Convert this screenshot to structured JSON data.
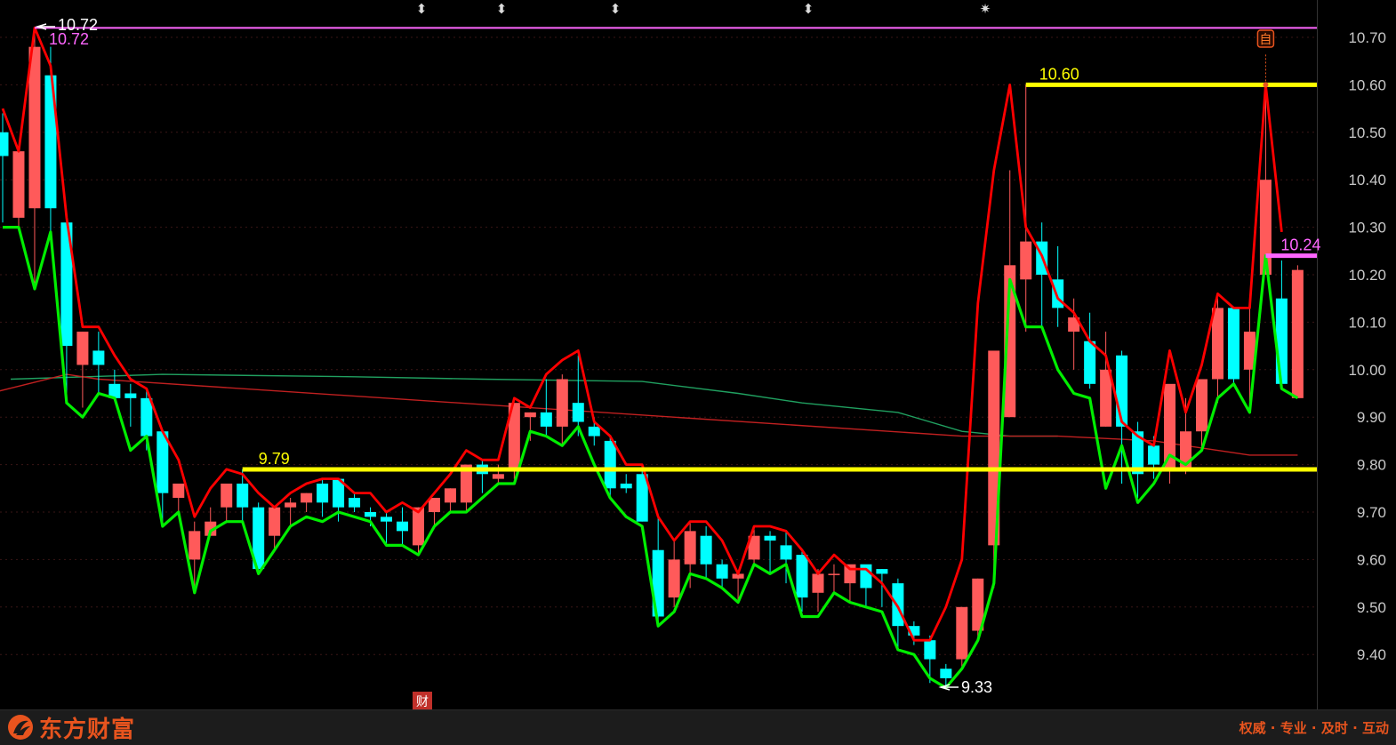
{
  "chart_data": {
    "type": "candlestick",
    "ylim": [
      9.3,
      10.75
    ],
    "y_ticks": [
      "10.70",
      "10.60",
      "10.50",
      "10.40",
      "10.30",
      "10.20",
      "10.10",
      "10.00",
      "9.90",
      "9.80",
      "9.70",
      "9.60",
      "9.50",
      "9.40"
    ],
    "candles": [
      [
        10.5,
        10.54,
        10.45,
        10.31
      ],
      [
        10.32,
        10.38,
        10.46,
        10.3
      ],
      [
        10.34,
        10.72,
        10.68,
        10.18
      ],
      [
        10.62,
        10.68,
        10.34,
        10.29
      ],
      [
        10.31,
        10.31,
        10.05,
        9.95
      ],
      [
        10.01,
        10.08,
        10.08,
        9.92
      ],
      [
        10.04,
        10.08,
        10.01,
        9.95
      ],
      [
        9.97,
        10.0,
        9.94,
        9.94
      ],
      [
        9.95,
        9.97,
        9.94,
        9.88
      ],
      [
        9.94,
        9.96,
        9.86,
        9.83
      ],
      [
        9.87,
        9.87,
        9.74,
        9.67
      ],
      [
        9.73,
        9.75,
        9.76,
        9.7
      ],
      [
        9.6,
        9.68,
        9.66,
        9.53
      ],
      [
        9.65,
        9.71,
        9.68,
        9.66
      ],
      [
        9.71,
        9.75,
        9.76,
        9.68
      ],
      [
        9.76,
        9.79,
        9.71,
        9.68
      ],
      [
        9.71,
        9.72,
        9.58,
        9.57
      ],
      [
        9.65,
        9.7,
        9.71,
        9.62
      ],
      [
        9.71,
        9.73,
        9.72,
        9.67
      ],
      [
        9.72,
        9.74,
        9.74,
        9.7
      ],
      [
        9.76,
        9.77,
        9.72,
        9.69
      ],
      [
        9.77,
        9.77,
        9.71,
        9.68
      ],
      [
        9.73,
        9.74,
        9.71,
        9.7
      ],
      [
        9.7,
        9.71,
        9.69,
        9.67
      ],
      [
        9.69,
        9.7,
        9.68,
        9.63
      ],
      [
        9.68,
        9.71,
        9.66,
        9.63
      ],
      [
        9.63,
        9.71,
        9.71,
        9.61
      ],
      [
        9.7,
        9.73,
        9.73,
        9.67
      ],
      [
        9.72,
        9.75,
        9.75,
        9.7
      ],
      [
        9.72,
        9.8,
        9.8,
        9.7
      ],
      [
        9.8,
        9.81,
        9.78,
        9.74
      ],
      [
        9.77,
        9.8,
        9.78,
        9.76
      ],
      [
        9.79,
        9.93,
        9.93,
        9.77
      ],
      [
        9.9,
        9.91,
        9.91,
        9.85
      ],
      [
        9.91,
        9.98,
        9.88,
        9.86
      ],
      [
        9.88,
        9.99,
        9.98,
        9.84
      ],
      [
        9.93,
        10.03,
        9.89,
        9.86
      ],
      [
        9.88,
        9.9,
        9.86,
        9.84
      ],
      [
        9.85,
        9.86,
        9.75,
        9.73
      ],
      [
        9.76,
        9.78,
        9.75,
        9.74
      ],
      [
        9.78,
        9.8,
        9.68,
        9.68
      ],
      [
        9.62,
        9.69,
        9.48,
        9.46
      ],
      [
        9.52,
        9.64,
        9.6,
        9.5
      ],
      [
        9.59,
        9.68,
        9.66,
        9.54
      ],
      [
        9.65,
        9.67,
        9.59,
        9.56
      ],
      [
        9.59,
        9.6,
        9.56,
        9.54
      ],
      [
        9.56,
        9.57,
        9.57,
        9.51
      ],
      [
        9.6,
        9.67,
        9.65,
        9.59
      ],
      [
        9.65,
        9.66,
        9.64,
        9.57
      ],
      [
        9.63,
        9.66,
        9.6,
        9.55
      ],
      [
        9.61,
        9.62,
        9.52,
        9.49
      ],
      [
        9.53,
        9.58,
        9.57,
        9.49
      ],
      [
        9.57,
        9.59,
        9.57,
        9.53
      ],
      [
        9.55,
        9.58,
        9.59,
        9.51
      ],
      [
        9.59,
        9.58,
        9.54,
        9.5
      ],
      [
        9.58,
        9.58,
        9.57,
        9.5
      ],
      [
        9.55,
        9.56,
        9.46,
        9.41
      ],
      [
        9.46,
        9.47,
        9.44,
        9.42
      ],
      [
        9.43,
        9.44,
        9.39,
        9.34
      ],
      [
        9.37,
        9.38,
        9.35,
        9.33
      ],
      [
        9.39,
        9.5,
        9.5,
        9.37
      ],
      [
        9.45,
        9.56,
        9.56,
        9.43
      ],
      [
        9.63,
        10.04,
        10.04,
        9.54
      ],
      [
        9.9,
        10.42,
        10.22,
        9.91
      ],
      [
        10.19,
        10.6,
        10.27,
        10.08
      ],
      [
        10.27,
        10.31,
        10.2,
        10.09
      ],
      [
        10.19,
        10.26,
        10.13,
        10.09
      ],
      [
        10.08,
        10.15,
        10.11,
        10.0
      ],
      [
        10.06,
        10.12,
        9.97,
        9.96
      ],
      [
        9.88,
        10.08,
        10.0,
        9.88
      ],
      [
        10.03,
        10.04,
        9.88,
        9.76
      ],
      [
        9.87,
        9.89,
        9.78,
        9.73
      ],
      [
        9.84,
        9.86,
        9.8,
        9.77
      ],
      [
        9.79,
        9.86,
        9.97,
        9.76
      ],
      [
        9.79,
        9.94,
        9.87,
        9.78
      ],
      [
        9.87,
        9.97,
        9.98,
        9.83
      ],
      [
        9.98,
        10.15,
        10.13,
        9.93
      ],
      [
        10.13,
        10.12,
        9.98,
        9.97
      ],
      [
        10.0,
        10.13,
        10.08,
        9.91
      ],
      [
        10.2,
        10.6,
        10.4,
        10.24
      ],
      [
        10.15,
        10.23,
        9.97,
        9.97
      ],
      [
        9.94,
        10.22,
        10.21,
        9.94
      ]
    ],
    "upper_band": [
      10.55,
      10.46,
      10.72,
      10.64,
      10.32,
      10.09,
      10.09,
      10.03,
      9.98,
      9.96,
      9.87,
      9.81,
      9.69,
      9.75,
      9.79,
      9.78,
      9.74,
      9.71,
      9.74,
      9.76,
      9.77,
      9.77,
      9.74,
      9.74,
      9.7,
      9.72,
      9.7,
      9.74,
      9.78,
      9.83,
      9.81,
      9.81,
      9.94,
      9.92,
      9.99,
      10.02,
      10.04,
      9.89,
      9.86,
      9.8,
      9.8,
      9.69,
      9.64,
      9.68,
      9.68,
      9.64,
      9.57,
      9.67,
      9.67,
      9.66,
      9.62,
      9.57,
      9.61,
      9.58,
      9.58,
      9.55,
      9.5,
      9.43,
      9.43,
      9.5,
      9.6,
      10.14,
      10.42,
      10.6,
      10.3,
      10.24,
      10.15,
      10.12,
      10.06,
      10.03,
      9.89,
      9.86,
      9.84,
      10.04,
      9.91,
      10.01,
      10.16,
      10.13,
      10.13,
      10.6,
      10.29
    ],
    "lower_band": [
      10.3,
      10.3,
      10.17,
      10.29,
      9.93,
      9.9,
      9.95,
      9.94,
      9.83,
      9.86,
      9.67,
      9.7,
      9.53,
      9.66,
      9.68,
      9.68,
      9.57,
      9.62,
      9.67,
      9.69,
      9.68,
      9.7,
      9.69,
      9.68,
      9.63,
      9.63,
      9.61,
      9.67,
      9.7,
      9.7,
      9.73,
      9.76,
      9.76,
      9.87,
      9.86,
      9.84,
      9.88,
      9.8,
      9.73,
      9.69,
      9.67,
      9.46,
      9.49,
      9.57,
      9.56,
      9.54,
      9.51,
      9.59,
      9.57,
      9.59,
      9.48,
      9.48,
      9.53,
      9.51,
      9.5,
      9.49,
      9.41,
      9.4,
      9.35,
      9.33,
      9.37,
      9.43,
      9.55,
      10.19,
      10.09,
      10.09,
      10.0,
      9.95,
      9.94,
      9.75,
      9.84,
      9.72,
      9.76,
      9.82,
      9.8,
      9.83,
      9.94,
      9.97,
      9.91,
      10.24,
      9.96,
      9.94
    ],
    "ma_green": [
      [
        0.5,
        9.98
      ],
      [
        10,
        9.99
      ],
      [
        22,
        9.985
      ],
      [
        30,
        9.98
      ],
      [
        40,
        9.975
      ],
      [
        46,
        9.95
      ],
      [
        50,
        9.93
      ],
      [
        56,
        9.91
      ],
      [
        60,
        9.87
      ],
      [
        63,
        9.86
      ],
      [
        66,
        9.86
      ]
    ],
    "ma_red": [
      [
        -2,
        9.94
      ],
      [
        4,
        9.99
      ],
      [
        6,
        9.98
      ],
      [
        60,
        9.86
      ],
      [
        66,
        9.86
      ],
      [
        72,
        9.85
      ],
      [
        78,
        9.82
      ],
      [
        81,
        9.82
      ]
    ],
    "hlines": [
      {
        "value": 10.72,
        "from": 2,
        "color": "#ff66ff",
        "width": 2
      },
      {
        "value": 10.6,
        "from": 64,
        "color": "#ffff00",
        "width": 5
      },
      {
        "value": 9.79,
        "from": 15,
        "color": "#ffff00",
        "width": 5
      },
      {
        "value": 10.24,
        "from": 79,
        "color": "#ff66ff",
        "width": 5
      }
    ],
    "annotations": {
      "high_arrow_label": "10.72",
      "high_value_label": "10.72",
      "level_1060": "10.60",
      "level_979": "9.79",
      "level_1024": "10.24",
      "low_arrow_label": "9.33"
    },
    "markers": {
      "zi_badge": "自",
      "cai_badge": "财"
    },
    "top_symbols": [
      "⬍",
      "⬍",
      "⬍",
      "⬍",
      "✷"
    ],
    "colors": {
      "up": "#ff5a5a",
      "down": "#00ffff",
      "upper_band": "#ff0000",
      "lower_band": "#00ee00",
      "ma_green": "#20a060",
      "ma_red": "#c02020",
      "axis_text": "#c8c8c8",
      "grid": "#3a1616"
    }
  },
  "footer": {
    "brand": "东方财富",
    "slogan": "权威 · 专业 · 及时 · 互动"
  }
}
